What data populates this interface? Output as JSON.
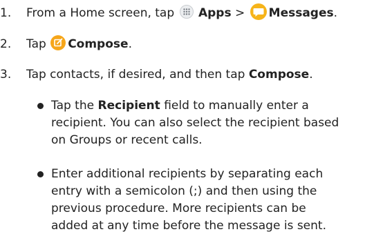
{
  "steps": [
    {
      "number": "1.",
      "text_a": "From a Home screen, tap",
      "apps_label": "Apps",
      "separator": ">",
      "messages_label": "Messages",
      "end": "."
    },
    {
      "number": "2.",
      "text_a": "Tap",
      "compose_label": "Compose",
      "end": "."
    },
    {
      "number": "3.",
      "text_a": "Tap contacts, if desired, and then tap",
      "compose_label": "Compose",
      "end": "."
    }
  ],
  "bullets": [
    {
      "line1_a": "Tap the",
      "line1_bold": "Recipient",
      "line1_b": "field to manually enter a",
      "line2": "recipient. You can also select the recipient based",
      "line3": "on Groups or recent calls."
    },
    {
      "line1": "Enter additional recipients by separating each",
      "line2": "entry with a semicolon (;) and then using the",
      "line3": "previous procedure. More recipients can be",
      "line4": "added at any time before the message is sent."
    }
  ],
  "icons": {
    "apps": "apps-grid-icon",
    "messages": "messages-bubble-icon",
    "compose": "compose-pencil-icon"
  },
  "colors": {
    "text": "#222222",
    "accent_orange": "#f6a61a",
    "messages_yellow": "#f6b41a"
  }
}
